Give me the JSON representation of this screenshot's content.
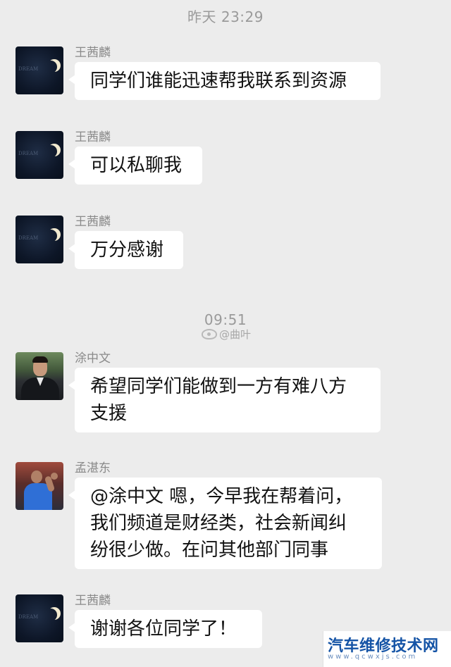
{
  "timestamps": {
    "first": "昨天 23:29",
    "second": "09:51"
  },
  "watermark": {
    "weibo_text": "@曲叶",
    "weibo_icon": "weibo-icon"
  },
  "messages": [
    {
      "sender": "王茜麟",
      "avatar": "moon-avatar",
      "text": "同学们谁能迅速帮我联系到资源"
    },
    {
      "sender": "王茜麟",
      "avatar": "moon-avatar",
      "text": "可以私聊我"
    },
    {
      "sender": "王茜麟",
      "avatar": "moon-avatar",
      "text": "万分感谢"
    },
    {
      "sender": "涂中文",
      "avatar": "man-portrait-avatar",
      "text": "希望同学们能做到一方有难八方\n支援"
    },
    {
      "sender": "孟湛东",
      "avatar": "tennis-player-avatar",
      "text": "@涂中文 嗯，今早我在帮着问，\n我们频道是财经类，社会新闻纠\n纷很少做。在问其他部门同事"
    },
    {
      "sender": "王茜麟",
      "avatar": "moon-avatar",
      "text": "谢谢各位同学了！"
    }
  ],
  "corner_logo": {
    "title": "汽车维修技术网",
    "url": "www.qcwxjs.com"
  },
  "colors": {
    "background": "#ececec",
    "bubble": "#ffffff",
    "sender_name": "#8a8a8a",
    "timestamp": "#9a9a9a",
    "logo_blue": "#1554a6"
  }
}
